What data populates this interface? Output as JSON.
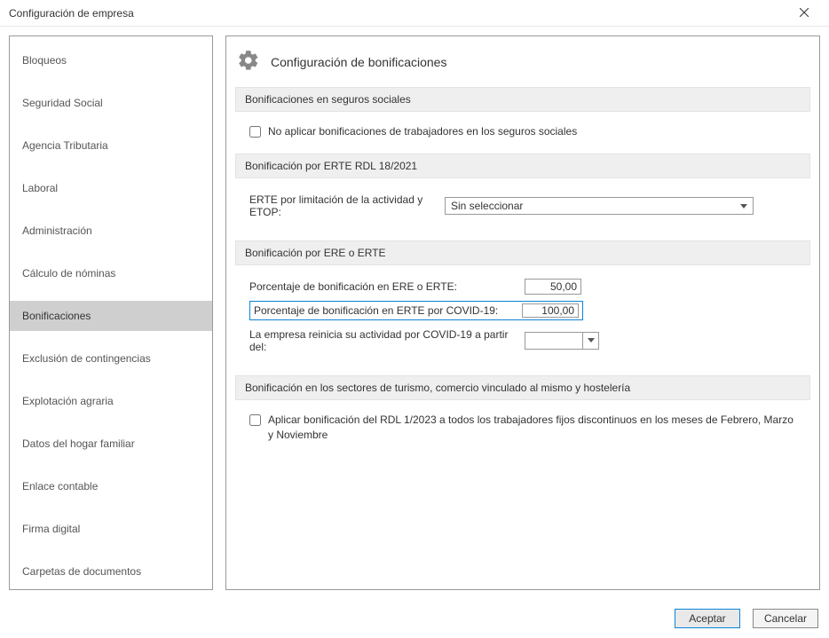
{
  "window": {
    "title": "Configuración de empresa"
  },
  "sidebar": {
    "items": [
      {
        "label": "Bloqueos"
      },
      {
        "label": "Seguridad Social"
      },
      {
        "label": "Agencia Tributaria"
      },
      {
        "label": "Laboral"
      },
      {
        "label": "Administración"
      },
      {
        "label": "Cálculo de nóminas"
      },
      {
        "label": "Bonificaciones",
        "selected": true
      },
      {
        "label": "Exclusión de contingencias"
      },
      {
        "label": "Explotación agraria"
      },
      {
        "label": "Datos del hogar familiar"
      },
      {
        "label": "Enlace contable"
      },
      {
        "label": "Firma digital"
      },
      {
        "label": "Carpetas de documentos"
      }
    ]
  },
  "main": {
    "page_title": "Configuración de bonificaciones",
    "sections": {
      "seguros": {
        "title": "Bonificaciones en seguros sociales",
        "no_aplicar_label": "No aplicar bonificaciones de trabajadores en los seguros sociales"
      },
      "erte_rdl": {
        "title": "Bonificación por ERTE RDL 18/2021",
        "label": "ERTE por limitación de la actividad y ETOP:",
        "selected": "Sin seleccionar"
      },
      "ere_erte": {
        "title": "Bonificación por ERE o ERTE",
        "pct_ere_label": "Porcentaje de bonificación en ERE o ERTE:",
        "pct_ere_value": "50,00",
        "pct_covid_label": "Porcentaje de bonificación en ERTE por COVID-19:",
        "pct_covid_value": "100,00",
        "reinicia_label": "La empresa reinicia su actividad por COVID-19 a partir del:",
        "reinicia_value": ""
      },
      "turismo": {
        "title": "Bonificación en los sectores de turismo, comercio vinculado al mismo y hostelería",
        "rdl_label": "Aplicar bonificación del RDL 1/2023 a todos los trabajadores fijos discontinuos en los meses de Febrero, Marzo y Noviembre"
      }
    }
  },
  "footer": {
    "accept": "Aceptar",
    "cancel": "Cancelar"
  }
}
